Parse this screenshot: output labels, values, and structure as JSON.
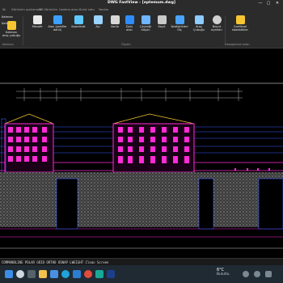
{
  "window": {
    "title": "DWG FastView - [eptemum.dwg]",
    "minimize": "—",
    "maximize": "▢",
    "close": "✕"
  },
  "tabs": [
    "İlk",
    "Görünüm açıklamalar",
    "3D Görünüm",
    "Uzatma aracı",
    "Bulut notu",
    "Yardım"
  ],
  "ribbon": {
    "left_rows": [
      "Katman",
      "Katman",
      "Katman"
    ],
    "buttons": [
      "Katman\naraç çubuğu",
      "Mesafe",
      "Alan (şekiller\ndahil)",
      "Koordinat",
      "Açı",
      "Varlık",
      "Dolu\nalan",
      "Çeyreği\ndüşün",
      "Kayıt",
      "İstatistikleri\nÖlç",
      "Araç\nÇubuğu",
      "Boyut\nayarları",
      "Grafiksel\nistatistikler"
    ],
    "group_labels": [
      "Katman",
      "Ölçüm",
      "Hesaplama tuları"
    ]
  },
  "command_bar": {
    "text": "COMMANDLINE  POLAR  GRID  ORTHO  OSNAP  LWEIGHT  Clean Screen"
  },
  "taskbar": {
    "icons": [
      "start-icon",
      "search-icon",
      "files-icon",
      "folder-icon",
      "store-icon",
      "edge-icon",
      "mail-icon",
      "chrome-icon",
      "app-icon",
      "dwg-icon"
    ],
    "weather_temp": "6°C",
    "weather_text": "Bulutlu"
  },
  "colors": {
    "accent_magenta": "#ff2bd6",
    "accent_blue": "#3a5bff",
    "accent_yellow": "#f7c531",
    "ribbon_bg": "#2b2b2b"
  }
}
